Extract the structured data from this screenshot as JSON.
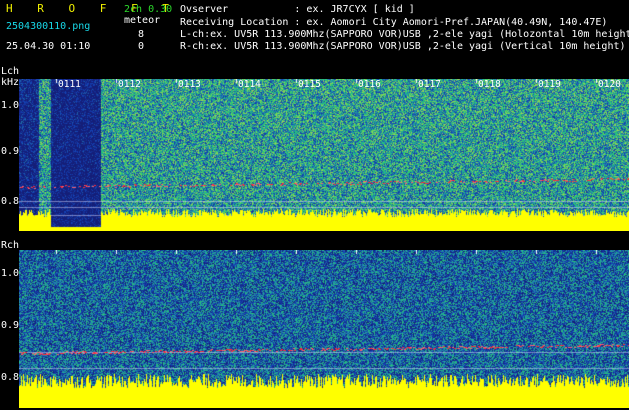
{
  "header": {
    "app_title": "H R O F F T",
    "filename": "2504300110.png",
    "datetime": "25.04.30 01:10",
    "mode": "2ch 0.30",
    "meteor_label": "meteor",
    "meteor_l_count": "8",
    "meteor_r_count": "0",
    "observer_line": "Ovserver           : ex. JR7CYX [ kid ]",
    "location_line": "Receiving Location : ex. Aomori City Aomori-Pref.JAPAN(40.49N, 140.47E)",
    "lch_line": "L-ch:ex. UV5R 113.900Mhz(SAPPORO VOR)USB ,2-ele yagi (Holozontal 10m height)",
    "rch_line": "R-ch:ex. UV5R 113.900Mhz(SAPPORO VOR)USB ,2-ele yagi (Vertical 10m height)"
  },
  "lch_panel": {
    "label": "Lch",
    "unit": "kHz",
    "y_ticks": [
      "1.0",
      "0.9",
      "0.8"
    ]
  },
  "rch_panel": {
    "label": "Rch",
    "y_ticks": [
      "1.0",
      "0.9",
      "0.8"
    ]
  },
  "time_ticks": [
    "0111",
    "0112",
    "0113",
    "0114",
    "0115",
    "0116",
    "0117",
    "0118",
    "0119",
    "0120"
  ],
  "colors": {
    "background": "#000000",
    "header_text": "#18d8e8",
    "meteor_text": "#2bd82b",
    "noise_floor": "#ffff00",
    "signal_trace": "#ff3040",
    "spectrum_low": "#1a2a8a",
    "spectrum_mid": "#22aa88"
  }
}
